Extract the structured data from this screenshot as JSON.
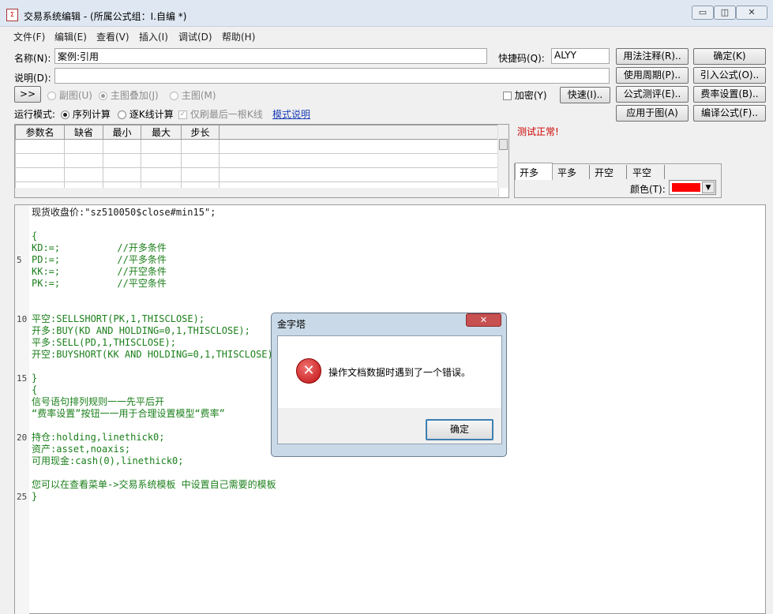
{
  "window": {
    "title": "交易系统编辑 - (所属公式组：I.自编 *)",
    "min_label": "▭",
    "max_label": "◫",
    "close_label": "✕"
  },
  "menu": [
    "文件(F)",
    "编辑(E)",
    "查看(V)",
    "插入(I)",
    "调试(D)",
    "帮助(H)"
  ],
  "form": {
    "name_label": "名称(N):",
    "name_value": "案例:引用",
    "shortcut_label": "快捷码(Q):",
    "shortcut_value": "ALYY",
    "desc_label": "说明(D):",
    "desc_value": "",
    "expand_label": ">>",
    "radio_subchart": "副图(U)",
    "radio_overlay": "主图叠加(J)",
    "radio_main": "主图(M)",
    "encrypt_label": "加密(Y)",
    "run_mode_label": "运行模式:",
    "mode_sequence": "序列计算",
    "mode_bar": "逐K线计算",
    "last_bar_only": "仅刷最后一根K线",
    "mode_help_link": "模式说明"
  },
  "buttons": {
    "usage_notes": "用法注释(R)..",
    "confirm": "确定(K)",
    "usage_period": "使用周期(P)..",
    "import_formula": "引入公式(O)..",
    "formula_test": "公式测评(E)..",
    "fee_settings": "费率设置(B)..",
    "apply_to_chart": "应用于图(A)",
    "compile_formula": "编译公式(F)..",
    "quick": "快速(I).."
  },
  "params_table": {
    "headers": [
      "参数名",
      "缺省",
      "最小",
      "最大",
      "步长"
    ],
    "rows": 4
  },
  "status": {
    "test_ok": "测试正常!"
  },
  "signal_tabs": [
    "开多",
    "平多",
    "开空",
    "平空"
  ],
  "color": {
    "label": "颜色(T):",
    "value": "#ff0000"
  },
  "code_lines": [
    {
      "num": "",
      "text": "现货收盘价:\"sz510050$close#min15\";"
    },
    {
      "num": "",
      "text": ""
    },
    {
      "num": "",
      "text": "{"
    },
    {
      "num": "",
      "text": "KD:=;          //开多条件"
    },
    {
      "num": "5",
      "text": "PD:=;          //平多条件"
    },
    {
      "num": "",
      "text": "KK:=;          //开空条件"
    },
    {
      "num": "",
      "text": "PK:=;          //平空条件"
    },
    {
      "num": "",
      "text": ""
    },
    {
      "num": "",
      "text": ""
    },
    {
      "num": "10",
      "text": "平空:SELLSHORT(PK,1,THISCLOSE);"
    },
    {
      "num": "",
      "text": "开多:BUY(KD AND HOLDING=0,1,THISCLOSE);"
    },
    {
      "num": "",
      "text": "平多:SELL(PD,1,THISCLOSE);"
    },
    {
      "num": "",
      "text": "开空:BUYSHORT(KK AND HOLDING=0,1,THISCLOSE);"
    },
    {
      "num": "",
      "text": ""
    },
    {
      "num": "15",
      "text": "}"
    },
    {
      "num": "",
      "text": "{"
    },
    {
      "num": "",
      "text": "信号语句排列规则一一先平后开"
    },
    {
      "num": "",
      "text": "“费率设置”按钮一一用于合理设置模型“费率”"
    },
    {
      "num": "",
      "text": ""
    },
    {
      "num": "20",
      "text": "持仓:holding,linethick0;"
    },
    {
      "num": "",
      "text": "资产:asset,noaxis;"
    },
    {
      "num": "",
      "text": "可用现金:cash(0),linethick0;"
    },
    {
      "num": "",
      "text": ""
    },
    {
      "num": "",
      "text": "您可以在查看菜单->交易系统模板 中设置自己需要的模板"
    },
    {
      "num": "25",
      "text": "}"
    }
  ],
  "dialog": {
    "title": "金字塔",
    "message": "操作文档数据时遇到了一个错误。",
    "ok": "确定",
    "close_label": "✕"
  }
}
